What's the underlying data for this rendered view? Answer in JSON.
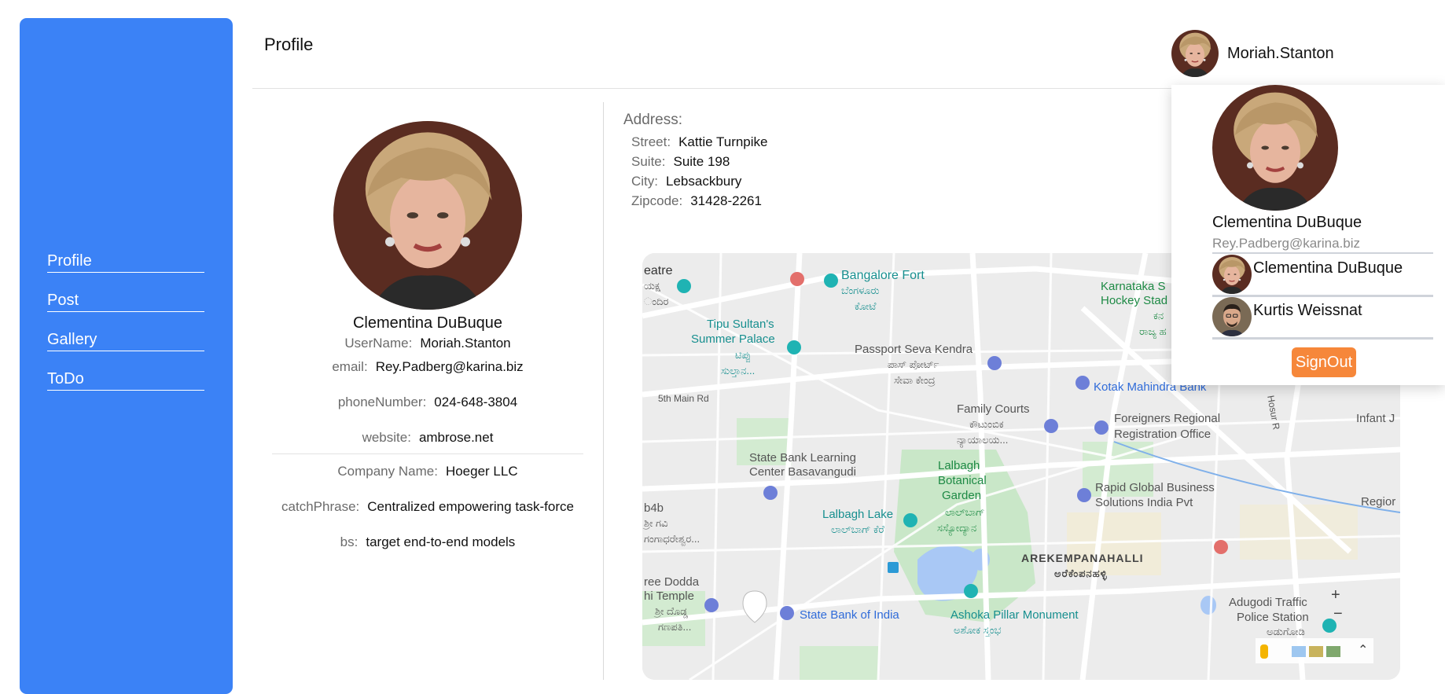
{
  "sidebar": {
    "items": [
      {
        "label": "Profile"
      },
      {
        "label": "Post"
      },
      {
        "label": "Gallery"
      },
      {
        "label": "ToDo"
      }
    ]
  },
  "header": {
    "title": "Profile",
    "username": "Moriah.Stanton"
  },
  "profile": {
    "name": "Clementina DuBuque",
    "username_label": "UserName:",
    "username": "Moriah.Stanton",
    "email_label": "email:",
    "email": "Rey.Padberg@karina.biz",
    "phone_label": "phoneNumber:",
    "phone": "024-648-3804",
    "website_label": "website:",
    "website": "ambrose.net",
    "company_label": "Company Name:",
    "company": "Hoeger LLC",
    "catchphrase_label": "catchPhrase:",
    "catchphrase": "Centralized empowering task-force",
    "bs_label": "bs:",
    "bs": "target end-to-end models"
  },
  "address": {
    "heading": "Address:",
    "street_label": "Street:",
    "street": "Kattie Turnpike",
    "suite_label": "Suite:",
    "suite": "Suite 198",
    "city_label": "City:",
    "city": "Lebsackbury",
    "zip_label": "Zipcode:",
    "zip": "31428-2261"
  },
  "map": {
    "labels": {
      "theatre": "eatre",
      "theatre_kn": "ಯಕ್ಷ",
      "theatre_kn2": "ಂದಿರ",
      "bangalore_fort": "Bangalore Fort",
      "bangalore_fort_kn": "ಬೆಂಗಳೂರು",
      "bangalore_fort_kn2": "ಕೋಟೆ",
      "tipu_1": "Tipu Sultan's",
      "tipu_2": "Summer Palace",
      "tipu_kn": "ಟಿಪ್ಪು",
      "tipu_kn2": "ಸುಲ್ತಾನ...",
      "passport": "Passport Seva Kendra",
      "passport_kn": "ಪಾಸ್ ಪೋರ್ಟ್",
      "passport_kn2": "ಸೇವಾ ಕೇಂದ್ರ",
      "karnataka_1": "Karnataka S",
      "karnataka_2": "Hockey Stad",
      "karnataka_kn": "ಕನ",
      "karnataka_kn2": "ರಾಜ್ಯ ಹ",
      "kotak": "Kotak Mahindra Bank",
      "fifth_main": "5th Main Rd",
      "family_courts": "Family Courts",
      "family_kn": "ಕೌಟುಂಬಿಕ",
      "family_kn2": "ನ್ಯಾಯಾಲಯ...",
      "foreigners_1": "Foreigners Regional",
      "foreigners_2": "Registration Office",
      "infant": "Infant J",
      "sbl_1": "State Bank Learning",
      "sbl_2": "Center Basavangudi",
      "lalbagh_1": "Lalbagh",
      "lalbagh_2": "Botanical",
      "lalbagh_3": "Garden",
      "lalbagh_kn": "ಲಾಲ್‌ಬಾಗ್",
      "lalbagh_kn2": "ಸಸ್ಯೋದ್ಯಾನ",
      "rapid_1": "Rapid Global Business",
      "rapid_2": "Solutions India Pvt",
      "region": "Regior",
      "b4b": "b4b",
      "b4b_kn": "ಶ್ರೀ ಗವಿ",
      "b4b_kn2": "ಗಂಗಾಧರೇಶ್ವರ...",
      "lalbagh_lake": "Lalbagh Lake",
      "lalbagh_lake_kn": "ಲಾಲ್‌ಬಾಗ್ ಕೆರೆ",
      "arekempanahalli": "AREKEMPANAHALLI",
      "arekempanahalli_kn": "ಅರೆಕೆಂಪನಹಳ್ಳಿ",
      "dodda_1": "ree Dodda",
      "dodda_2": "hi Temple",
      "dodda_kn": "ಶ್ರೀ ದೊಡ್ಡ",
      "dodda_kn2": "ಗಣಪತಿ...",
      "sbi": "State Bank of India",
      "ashoka": "Ashoka Pillar Monument",
      "ashoka_kn": "ಅಶೋಕ ಸ್ತಂಭ",
      "adugodi_1": "Adugodi Traffic",
      "adugodi_2": "Police Station",
      "adugodi_kn": "ಅಡುಗೋಡಿ",
      "hosur": "Hosur R"
    }
  },
  "popup": {
    "name": "Clementina DuBuque",
    "email": "Rey.Padberg@karina.biz",
    "accounts": [
      {
        "name": "Clementina DuBuque"
      },
      {
        "name": "Kurtis Weissnat"
      }
    ],
    "signout_label": "SignOut"
  },
  "colors": {
    "sidebar": "#3b82f6",
    "signout": "#f6873a",
    "map_green": "#c9e7c8",
    "map_water": "#a9c8f5"
  }
}
